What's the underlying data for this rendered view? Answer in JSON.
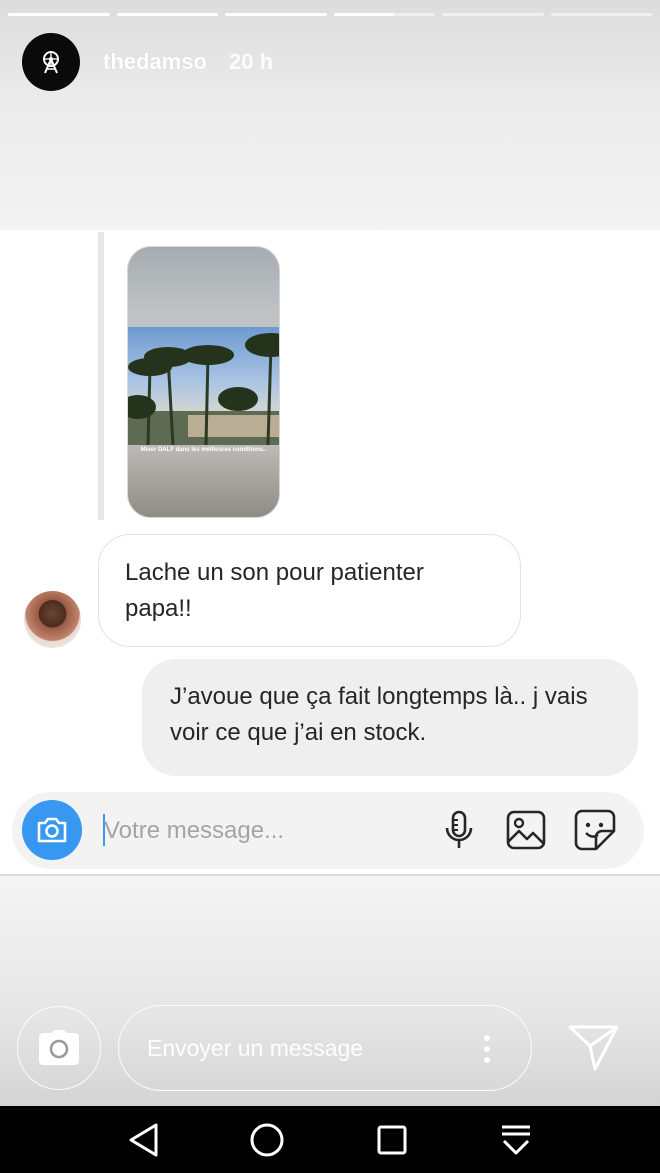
{
  "story": {
    "username": "thedamso",
    "time": "20 h",
    "progress": [
      1,
      1,
      1,
      0.6,
      0,
      0
    ],
    "avatar_icon": "ferris-wheel-logo-icon"
  },
  "chat": {
    "shared_story_caption": "Miser DALF dans les meilleures conditions..",
    "incoming_message": "Lache un son pour patienter papa!!",
    "outgoing_message": "J’avoue que ça fait longtemps là.. j vais voir ce que j’ai en stock."
  },
  "composer": {
    "placeholder": "Votre message...",
    "value": "",
    "accent_color": "#3897f0",
    "icons": [
      "camera-icon",
      "microphone-icon",
      "gallery-icon",
      "sticker-icon"
    ]
  },
  "story_reply": {
    "placeholder": "Envoyer un message",
    "icons": [
      "camera-icon",
      "more-options-icon",
      "send-icon"
    ]
  },
  "android_nav": {
    "icons": [
      "back-icon",
      "home-icon",
      "recents-icon",
      "notifications-down-icon"
    ]
  }
}
